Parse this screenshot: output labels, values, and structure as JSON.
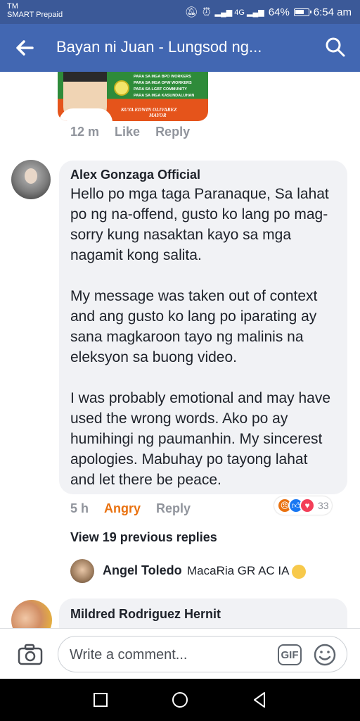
{
  "status_bar": {
    "carrier_line1": "TM",
    "carrier_line2": "SMART Prepaid",
    "signal": "4G",
    "battery": "64%",
    "time": "6:54 am"
  },
  "header": {
    "title": "Bayan ni Juan - Lungsod ng...",
    "back_icon": "back-arrow-icon",
    "search_icon": "search-icon"
  },
  "ad_image": {
    "lines": [
      "PARA SA MGA BPO WORKERS",
      "PARA SA MGA OFW WORKERS",
      "PARA SA LGBT COMMUNITY",
      "PARA SA MGA KASUNDALUHAN"
    ],
    "name": "KUYA EDWIN OLIVAREZ",
    "role": "MAYOR"
  },
  "first_comment_meta": {
    "time": "12 m",
    "like": "Like",
    "reply": "Reply"
  },
  "comment": {
    "author": "Alex Gonzaga Official",
    "text": "Hello po mga taga Paranaque, Sa lahat po ng na-offend, gusto ko lang po mag-sorry kung nasaktan kayo sa mga nagamit kong salita.\n\nMy message was taken out of context and ang gusto ko lang po iparating ay sana magkaroon tayo ng malinis na eleksyon sa buong video.\n\nI was probably emotional and may have used the wrong words. Ako po ay humihingi ng paumanhin.  My sincerest apologies. Mabuhay po tayong lahat and let there be peace.",
    "time": "5 h",
    "reaction_label": "Angry",
    "reply": "Reply",
    "reaction_icons": [
      "angry-react-icon",
      "like-react-icon",
      "love-react-icon"
    ],
    "reaction_count": "33"
  },
  "view_previous": "View 19 previous replies",
  "reply_preview": {
    "author": "Angel Toledo",
    "text": "MacaRia GR AC IA",
    "emoji": "laughing-emoji-icon"
  },
  "next_comment": {
    "author": "Mildred Rodriguez Hernit"
  },
  "composer": {
    "placeholder": "Write a comment...",
    "gif_label": "GIF",
    "camera_icon": "camera-icon",
    "sticker_icon": "smiley-icon"
  },
  "colors": {
    "header_bg": "#4267b2",
    "status_bg": "#3b5998",
    "angry": "#e9710f",
    "bubble_bg": "#f1f2f5"
  }
}
